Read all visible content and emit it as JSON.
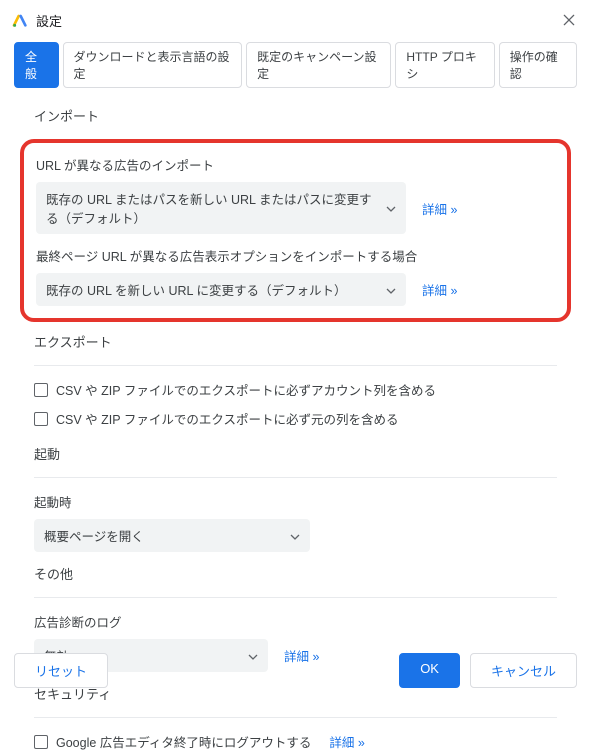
{
  "window": {
    "title": "設定"
  },
  "tabs": {
    "general": "全般",
    "download_lang": "ダウンロードと表示言語の設定",
    "campaign": "既定のキャンペーン設定",
    "http_proxy": "HTTP プロキシ",
    "confirm_ops": "操作の確認"
  },
  "sections": {
    "import": {
      "title": "インポート",
      "field1_label": "URL が異なる広告のインポート",
      "field1_value": "既存の URL またはパスを新しい URL またはパスに変更する（デフォルト）",
      "field1_link": "詳細 »",
      "field2_label": "最終ページ URL が異なる広告表示オプションをインポートする場合",
      "field2_value": "既存の URL を新しい URL に変更する（デフォルト）",
      "field2_link": "詳細 »"
    },
    "export": {
      "title": "エクスポート",
      "cb1": "CSV や ZIP ファイルでのエクスポートに必ずアカウント列を含める",
      "cb2": "CSV や ZIP ファイルでのエクスポートに必ず元の列を含める"
    },
    "startup": {
      "title": "起動",
      "label": "起動時",
      "value": "概要ページを開く"
    },
    "other": {
      "title": "その他",
      "label": "広告診断のログ",
      "value": "無効",
      "link": "詳細 »"
    },
    "security": {
      "title": "セキュリティ",
      "cb": "Google 広告エディタ終了時にログアウトする",
      "link": "詳細 »"
    }
  },
  "footer": {
    "reset": "リセット",
    "ok": "OK",
    "cancel": "キャンセル"
  }
}
